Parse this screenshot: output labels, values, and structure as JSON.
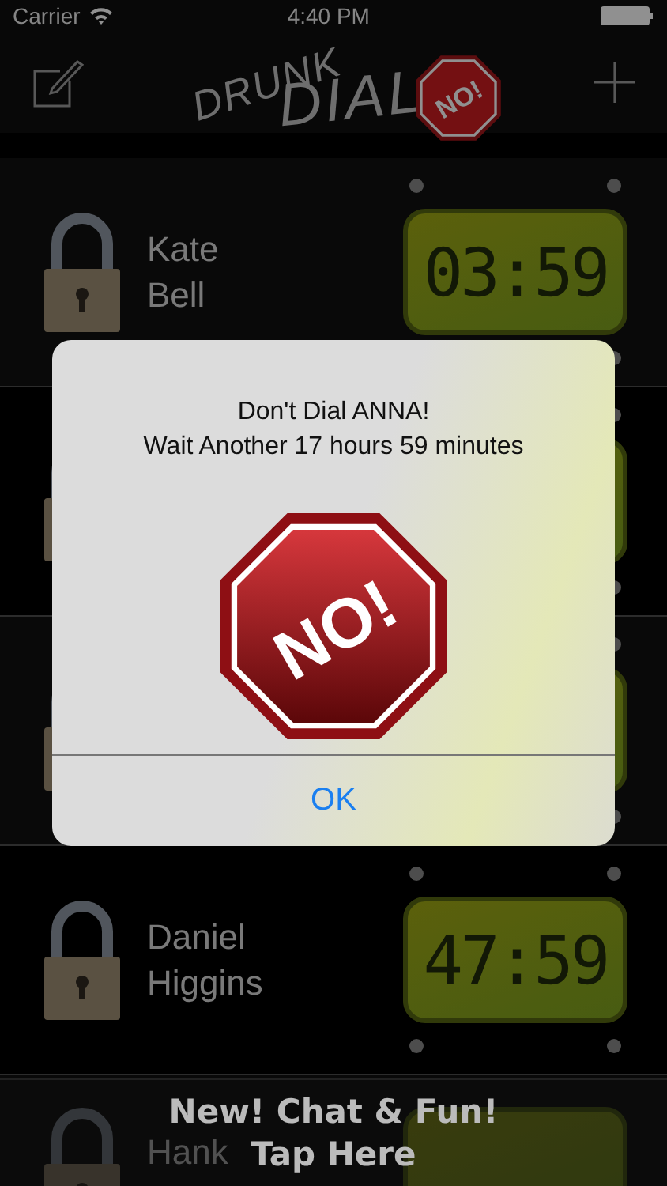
{
  "status_bar": {
    "carrier": "Carrier",
    "time": "4:40 PM"
  },
  "nav_bar": {
    "logo_top": "DRUNK",
    "logo_bottom": "DIAL",
    "logo_sign": "NO!"
  },
  "contacts": [
    {
      "kind": "contact",
      "first_name": "Kate",
      "last_name": "Bell",
      "timer": "03:59"
    },
    {
      "kind": "covered"
    },
    {
      "kind": "covered"
    },
    {
      "kind": "contact",
      "first_name": "Daniel",
      "last_name": "Higgins",
      "timer": "47:59"
    },
    {
      "kind": "partial",
      "first_name": "Hank"
    }
  ],
  "banner": {
    "line_1": "New! Chat & Fun!",
    "line_2": "Tap Here"
  },
  "alert": {
    "title": "Don't Dial ANNA!",
    "message": "Wait Another 17 hours 59 minutes",
    "sign_text": "NO!",
    "button": "OK"
  }
}
